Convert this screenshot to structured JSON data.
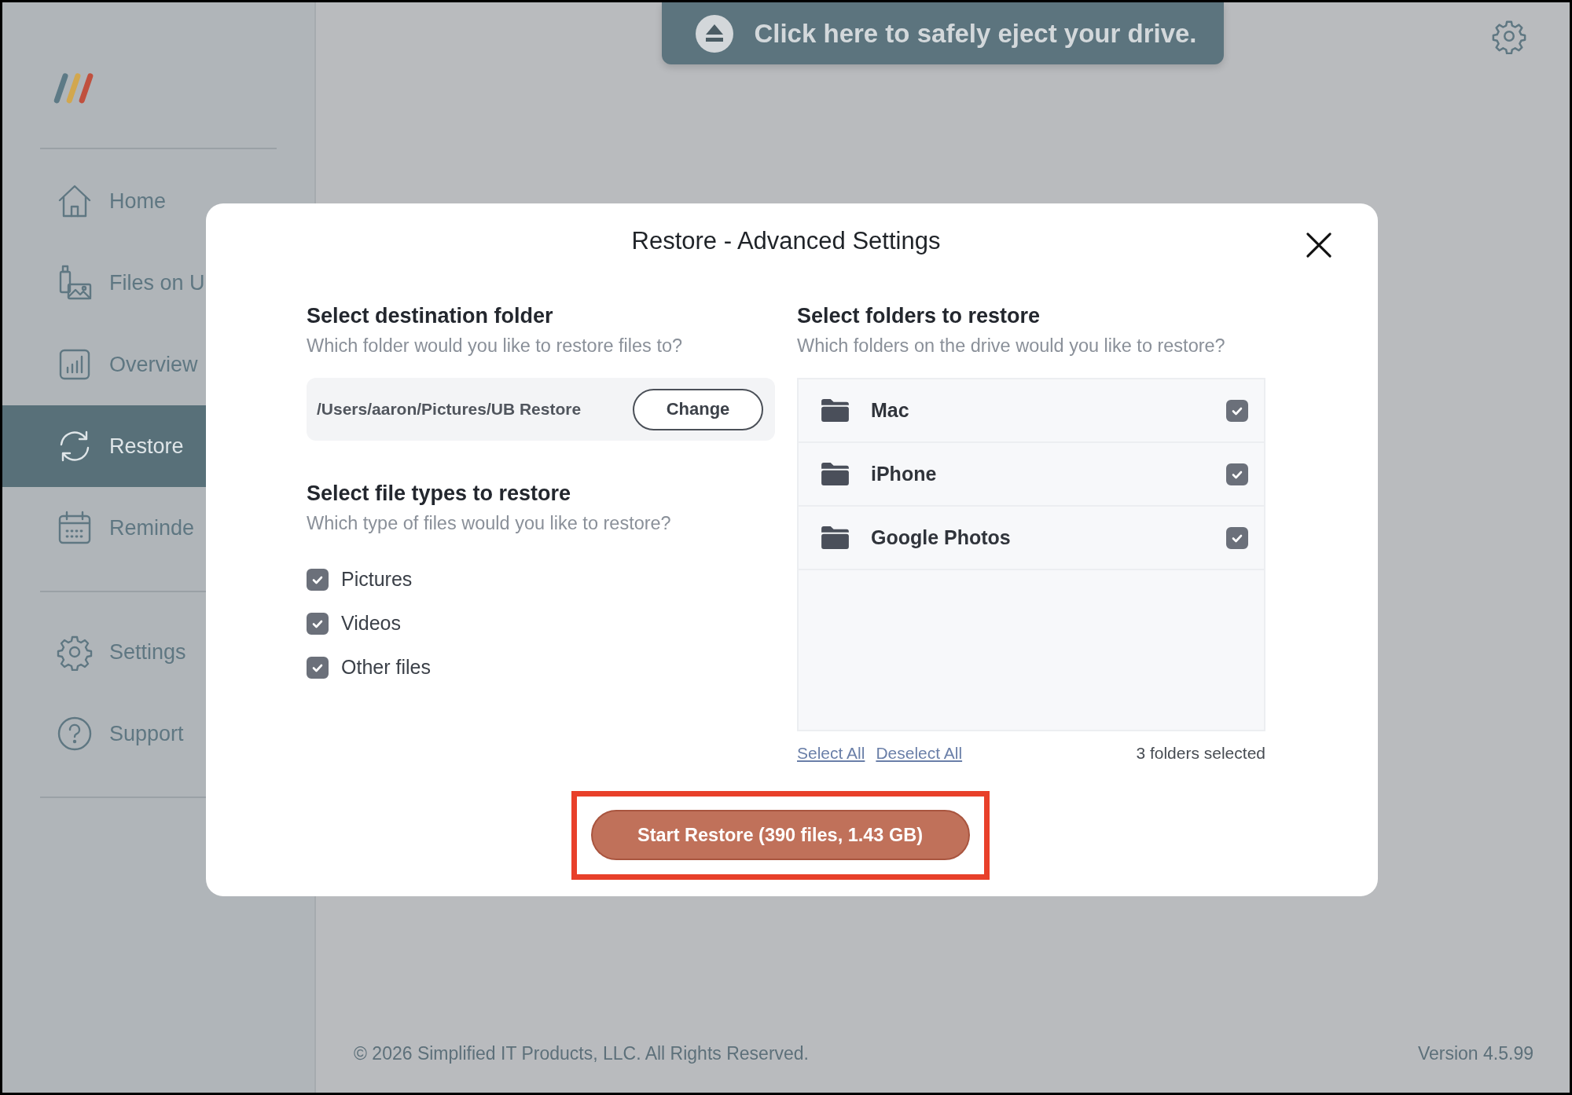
{
  "sidebar": {
    "items": [
      {
        "label": "Home",
        "selected": false
      },
      {
        "label": "Files on U",
        "selected": false
      },
      {
        "label": "Overview",
        "selected": false
      },
      {
        "label": "Restore",
        "selected": true
      },
      {
        "label": "Reminde",
        "selected": false
      }
    ],
    "bottom_items": [
      {
        "label": "Settings",
        "selected": false
      },
      {
        "label": "Support",
        "selected": false
      }
    ]
  },
  "eject_banner": {
    "label": "Click here to safely eject your drive."
  },
  "modal": {
    "title": "Restore - Advanced Settings",
    "destination": {
      "heading": "Select destination folder",
      "subtitle": "Which folder would you like to restore files to?",
      "path": "/Users/aaron/Pictures/UB Restore",
      "button": "Change"
    },
    "file_types": {
      "heading": "Select file types to restore",
      "subtitle": "Which type of files would you like to restore?",
      "items": [
        {
          "label": "Pictures",
          "checked": true
        },
        {
          "label": "Videos",
          "checked": true
        },
        {
          "label": "Other files",
          "checked": true
        }
      ]
    },
    "folders": {
      "heading": "Select folders to restore",
      "subtitle": "Which folders on the drive would you like to restore?",
      "items": [
        {
          "label": "Mac",
          "checked": true
        },
        {
          "label": "iPhone",
          "checked": true
        },
        {
          "label": "Google Photos",
          "checked": true
        }
      ],
      "select_all": "Select All",
      "deselect_all": "Deselect All",
      "count": "3 folders selected"
    },
    "start_button": {
      "label": "Start Restore (390 files, 1.43 GB)",
      "highlighted": true
    }
  },
  "footer": {
    "copyright": "© 2026 Simplified IT Products, LLC. All Rights Reserved.",
    "version": "Version 4.5.99"
  }
}
